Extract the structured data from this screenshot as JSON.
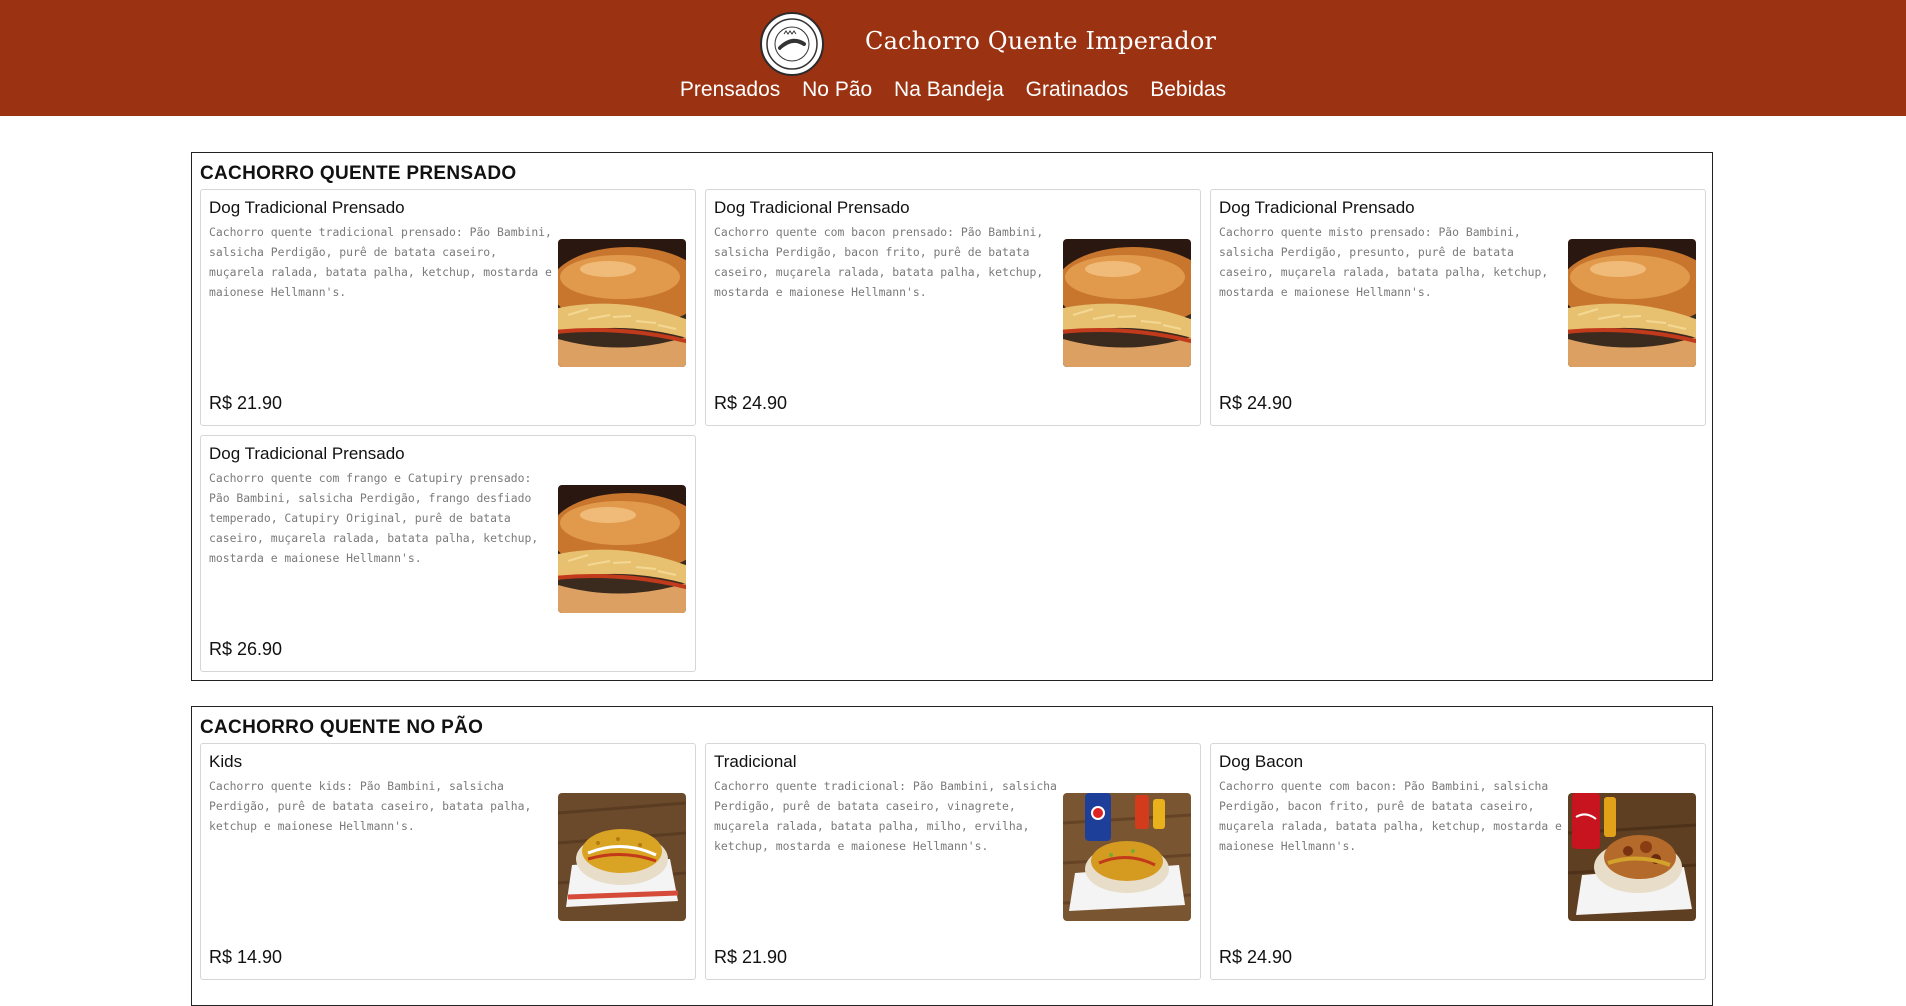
{
  "header": {
    "brand": "Cachorro Quente Imperador",
    "logo_text": "CACHORRO QUENTE IMPERADOR",
    "nav": [
      "Prensados",
      "No Pão",
      "Na Bandeja",
      "Gratinados",
      "Bebidas"
    ]
  },
  "sections": [
    {
      "title": "CACHORRO QUENTE PRENSADO",
      "items": [
        {
          "name": "Dog Tradicional Prensado",
          "description": "Cachorro quente tradicional prensado: Pão Bambini, salsicha Perdigão, purê de batata caseiro, muçarela ralada, batata palha, ketchup, mostarda e maionese Hellmann's.",
          "price": "R$ 21.90"
        },
        {
          "name": "Dog Tradicional Prensado",
          "description": "Cachorro quente com bacon prensado: Pão Bambini, salsicha Perdigão, bacon frito, purê de batata caseiro, muçarela ralada, batata palha, ketchup, mostarda e maionese Hellmann's.",
          "price": "R$ 24.90"
        },
        {
          "name": "Dog Tradicional Prensado",
          "description": "Cachorro quente misto prensado: Pão Bambini, salsicha Perdigão, presunto, purê de batata caseiro, muçarela ralada, batata palha, ketchup, mostarda e maionese Hellmann's.",
          "price": "R$ 24.90"
        },
        {
          "name": "Dog Tradicional Prensado",
          "description": "Cachorro quente com frango e Catupiry prensado: Pão Bambini, salsicha Perdigão, frango desfiado temperado, Catupiry Original, purê de batata caseiro, muçarela ralada, batata palha, ketchup, mostarda e maionese Hellmann's.",
          "price": "R$ 26.90"
        }
      ]
    },
    {
      "title": "CACHORRO QUENTE NO PÃO",
      "items": [
        {
          "name": "Kids",
          "description": "Cachorro quente kids: Pão Bambini, salsicha Perdigão, purê de batata caseiro, batata palha, ketchup e maionese Hellmann's.",
          "price": "R$ 14.90"
        },
        {
          "name": "Tradicional",
          "description": "Cachorro quente tradicional: Pão Bambini, salsicha Perdigão, purê de batata caseiro, vinagrete, muçarela ralada, batata palha, milho, ervilha, ketchup, mostarda e maionese Hellmann's.",
          "price": "R$ 21.90"
        },
        {
          "name": "Dog Bacon",
          "description": "Cachorro quente com bacon: Pão Bambini, salsicha Perdigão, bacon frito, purê de batata caseiro, muçarela ralada, batata palha, ketchup, mostarda e maionese Hellmann's.",
          "price": "R$ 24.90"
        }
      ]
    }
  ],
  "colors": {
    "header_bg": "#9b3313",
    "description_text": "#7a7a7a"
  }
}
